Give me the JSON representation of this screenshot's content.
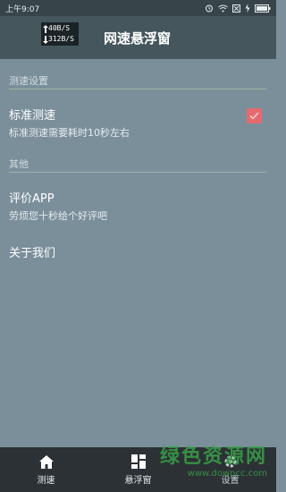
{
  "status_bar": {
    "time": "上午9:07"
  },
  "speed_badge": {
    "upload": "40B/S",
    "download": "312B/S"
  },
  "app_bar": {
    "title": "网速悬浮窗"
  },
  "sections": [
    {
      "header": "测速设置"
    },
    {
      "header": "其他"
    }
  ],
  "prefs": {
    "standard_speed_test": {
      "title": "标准测速",
      "summary": "标准测速需要耗时10秒左右",
      "checked": true
    },
    "rate_app": {
      "title": "评价APP",
      "summary": "劳烦您十秒给个好评吧"
    },
    "about": {
      "title": "关于我们"
    }
  },
  "bottom_nav": [
    {
      "label": "测速",
      "icon": "home-icon"
    },
    {
      "label": "悬浮窗",
      "icon": "dashboard-icon"
    },
    {
      "label": "设置",
      "icon": "settings-icon",
      "active": true
    }
  ],
  "watermark": {
    "logo": "绿色资源网",
    "url": "www.downcc.com"
  },
  "colors": {
    "background": "#7b8f9b",
    "app_bar": "#45565d",
    "accent": "#e56a6f",
    "divider": "#9db6a7",
    "nav": "#2b3134"
  }
}
